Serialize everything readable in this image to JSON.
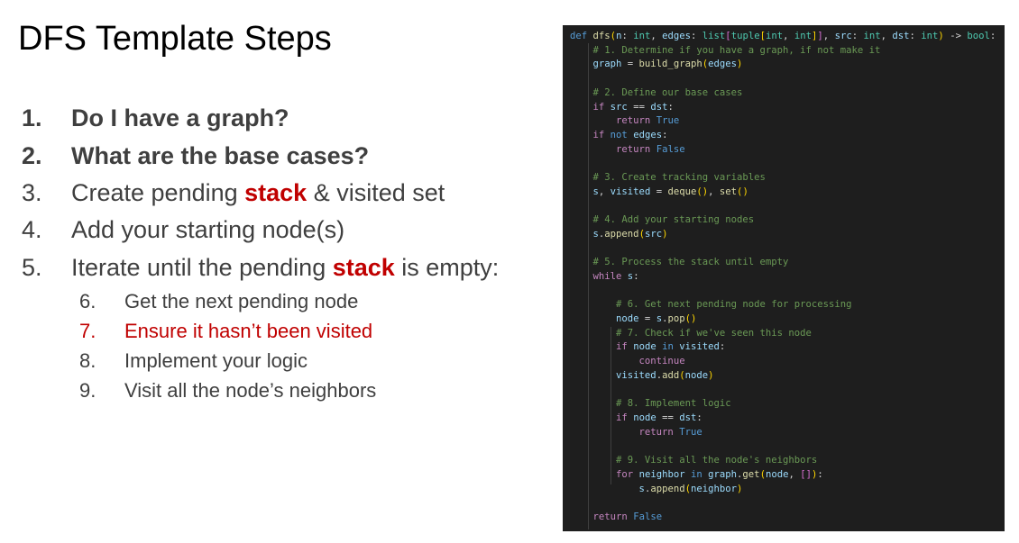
{
  "slide": {
    "title": "DFS Template Steps"
  },
  "steps": [
    {
      "num": "1.",
      "text": "Do I have a graph?"
    },
    {
      "num": "2.",
      "text": "What are the base cases?"
    },
    {
      "num": "3.",
      "pre": "Create pending ",
      "highlight": "stack",
      "post": " & visited set"
    },
    {
      "num": "4.",
      "text": "Add your starting node(s)"
    },
    {
      "num": "5.",
      "pre": "Iterate until the pending ",
      "highlight": "stack",
      "post": " is empty:"
    }
  ],
  "substeps": [
    {
      "num": "6.",
      "text": "Get the next pending node"
    },
    {
      "num": "7.",
      "text": "Ensure it hasn’t been visited"
    },
    {
      "num": "8.",
      "text": "Implement your logic"
    },
    {
      "num": "9.",
      "text": "Visit all the node’s neighbors"
    }
  ],
  "code": {
    "lines": [
      "def dfs(n: int, edges: list[tuple[int, int]], src: int, dst: int) -> bool:",
      "    # 1. Determine if you have a graph, if not make it",
      "    graph = build_graph(edges)",
      "",
      "    # 2. Define our base cases",
      "    if src == dst:",
      "        return True",
      "    if not edges:",
      "        return False",
      "",
      "    # 3. Create tracking variables",
      "    s, visited = deque(), set()",
      "",
      "    # 4. Add your starting nodes",
      "    s.append(src)",
      "",
      "    # 5. Process the stack until empty",
      "    while s:",
      "",
      "        # 6. Get next pending node for processing",
      "        node = s.pop()",
      "        # 7. Check if we've seen this node",
      "        if node in visited:",
      "            continue",
      "        visited.add(node)",
      "",
      "        # 8. Implement logic",
      "        if node == dst:",
      "            return True",
      "",
      "        # 9. Visit all the node's neighbors",
      "        for neighbor in graph.get(node, []):",
      "            s.append(neighbor)",
      "",
      "    return False"
    ]
  }
}
